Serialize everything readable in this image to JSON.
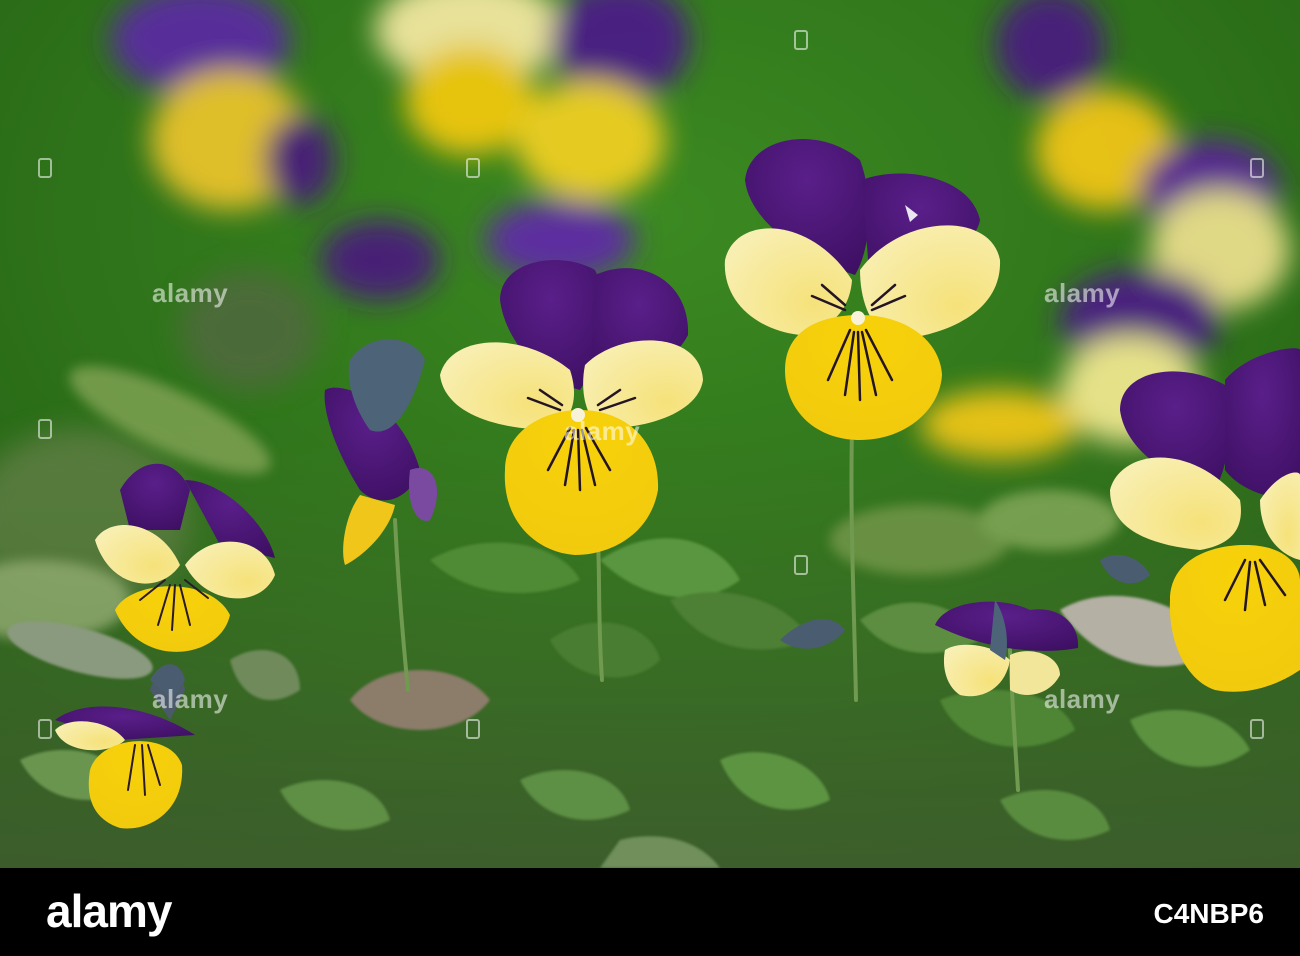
{
  "photo": {
    "subject": "purple and yellow viola flowers",
    "colors": {
      "background_green": "#2f7a1c",
      "petal_purple": "#4a1670",
      "petal_yellow": "#f2cf12",
      "petal_pale_yellow": "#f4ed9a",
      "leaf_green": "#5f8a3e"
    }
  },
  "watermark": {
    "text": "alamy"
  },
  "footer": {
    "logo": "alamy",
    "image_code": "C4NBP6"
  }
}
